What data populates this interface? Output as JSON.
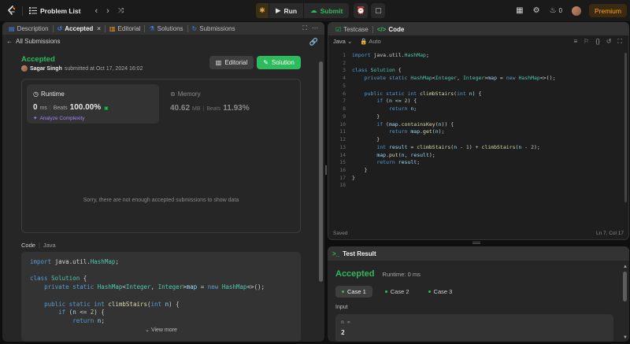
{
  "topnav": {
    "title": "Problem List",
    "run_label": "Run",
    "submit_label": "Submit",
    "coins": "0",
    "premium_label": "Premium"
  },
  "left": {
    "tabs": [
      {
        "label": "Description"
      },
      {
        "label": "Accepted"
      },
      {
        "label": "Editorial"
      },
      {
        "label": "Solutions"
      },
      {
        "label": "Submissions"
      }
    ],
    "back_label": "All Submissions",
    "status": "Accepted",
    "user": "Sagar Singh",
    "submitted_text": "submitted at Oct 17, 2024 16:02",
    "editorial_btn": "Editorial",
    "solution_btn": "Solution",
    "runtime": {
      "label": "Runtime",
      "value": "0",
      "unit": "ms",
      "beats_label": "Beats",
      "beats_pct": "100.00%",
      "analyze_label": "Analyze Complexity"
    },
    "memory": {
      "label": "Memory",
      "value": "40.62",
      "unit": "MB",
      "beats_label": "Beats",
      "beats_pct": "11.93%"
    },
    "empty_msg": "Sorry, there are not enough accepted submissions to show data",
    "code_label": "Code",
    "code_lang": "Java",
    "view_more": "View more"
  },
  "editor": {
    "tabs": [
      {
        "label": "Testcase"
      },
      {
        "label": "Code"
      }
    ],
    "language": "Java",
    "autosave": "Auto",
    "saved_label": "Saved",
    "cursor": "Ln 7, Col 17",
    "line_numbers": [
      "1",
      "2",
      "3",
      "4",
      "5",
      "6",
      "7",
      "8",
      "9",
      "10",
      "11",
      "12",
      "13",
      "14",
      "15",
      "16",
      "17",
      "18"
    ]
  },
  "result": {
    "title": "Test Result",
    "status": "Accepted",
    "runtime": "Runtime: 0 ms",
    "cases": [
      {
        "label": "Case 1"
      },
      {
        "label": "Case 2"
      },
      {
        "label": "Case 3"
      }
    ],
    "input_label": "Input",
    "var_name": "n =",
    "var_value": "2"
  },
  "colors": {
    "accent_green": "#2cbb5d",
    "premium_orange": "#ffa116",
    "analyze_purple": "#a883f2"
  }
}
